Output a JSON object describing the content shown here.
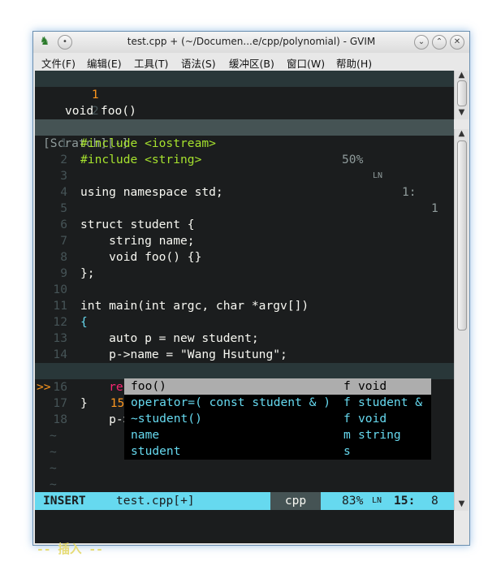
{
  "window": {
    "title": "test.cpp + (~/Documen...e/cpp/polynomial) - GVIM",
    "app_icon": "gvim-icon",
    "buttons": [
      "minimize",
      "maximize",
      "close"
    ]
  },
  "menubar": [
    "文件(F)",
    "编辑(E)",
    "工具(T)",
    "语法(S)",
    "缓冲区(B)",
    "窗口(W)",
    "帮助(H)"
  ],
  "top_pane": {
    "lines": [
      {
        "num": "1",
        "text": "void foo()"
      },
      {
        "num": "2",
        "text": ""
      }
    ],
    "tilde": "~",
    "status": {
      "name": "[Scratch][-]",
      "percent": "50%",
      "ln": "1:",
      "col": "1"
    }
  },
  "code_lines": [
    {
      "num": "1",
      "text": "#include <iostream>"
    },
    {
      "num": "2",
      "text": "#include <string>"
    },
    {
      "num": "3",
      "text": ""
    },
    {
      "num": "4",
      "text": "using namespace std;"
    },
    {
      "num": "5",
      "text": ""
    },
    {
      "num": "6",
      "text": "struct student {"
    },
    {
      "num": "7",
      "text": "    string name;"
    },
    {
      "num": "8",
      "text": "    void foo() {}"
    },
    {
      "num": "9",
      "text": "};"
    },
    {
      "num": "10",
      "text": ""
    },
    {
      "num": "11",
      "text": "int main(int argc, char *argv[])"
    },
    {
      "num": "12",
      "text": "{"
    },
    {
      "num": "13",
      "text": "    auto p = new student;"
    },
    {
      "num": "14",
      "text": "    p->name = \"Wang Hsutung\";"
    },
    {
      "num": "15",
      "text": "    p->foo"
    },
    {
      "num": "16",
      "text": "    re"
    },
    {
      "num": "17",
      "text": "}"
    },
    {
      "num": "18",
      "text": ""
    }
  ],
  "sign": ">>",
  "tildes": [
    "~",
    "~",
    "~",
    "~",
    "~"
  ],
  "completion": [
    {
      "word": "foo()",
      "kind": "f",
      "menu": "void"
    },
    {
      "word": "operator=( const student & )",
      "kind": "f",
      "menu": "student &"
    },
    {
      "word": "~student()",
      "kind": "f",
      "menu": "void"
    },
    {
      "word": "name",
      "kind": "m",
      "menu": "string"
    },
    {
      "word": "student",
      "kind": "s",
      "menu": ""
    }
  ],
  "airline": {
    "mode": "INSERT",
    "file": "test.cpp[+]",
    "filetype": "cpp",
    "percent": "83%",
    "ln": "15:",
    "col": "8"
  },
  "mode_message": "-- 插入 --",
  "colors": {
    "background": "#1b1d1e",
    "keyword": "#f92672",
    "type": "#66d9ef",
    "preproc": "#a6e22e",
    "string": "#e6db74",
    "airline": "#66d9ef"
  }
}
